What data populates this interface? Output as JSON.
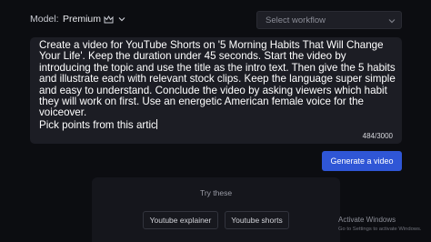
{
  "header": {
    "model_label": "Model:",
    "model_value": "Premium",
    "crown_icon": "crown-icon",
    "model_chevron_icon": "chevron-down-icon",
    "workflow_placeholder": "Select workflow",
    "workflow_chevron_icon": "chevron-down-icon"
  },
  "prompt": {
    "text": "Create a video for YouTube Shorts on '5 Morning Habits That Will Change Your Life'. Keep the duration under 45 seconds. Start the video by introducing the topic and use the title as the intro text. Then give the 5 habits and illustrate each with relevant stock clips. Keep the language super simple and easy to understand. Conclude the video by asking viewers which habit they will work on first. Use an energetic American female voice for the voiceover.\nPick points from this artic",
    "char_count": "484/3000"
  },
  "actions": {
    "generate_label": "Generate a video"
  },
  "try_these": {
    "title": "Try these",
    "chips": [
      "Youtube explainer",
      "Youtube shorts"
    ]
  },
  "watermark": {
    "title": "Activate Windows",
    "subtitle": "Go to Settings to activate Windows."
  },
  "colors": {
    "background": "#0c0d11",
    "panel": "#1c1d24",
    "accent": "#2f56d6"
  }
}
